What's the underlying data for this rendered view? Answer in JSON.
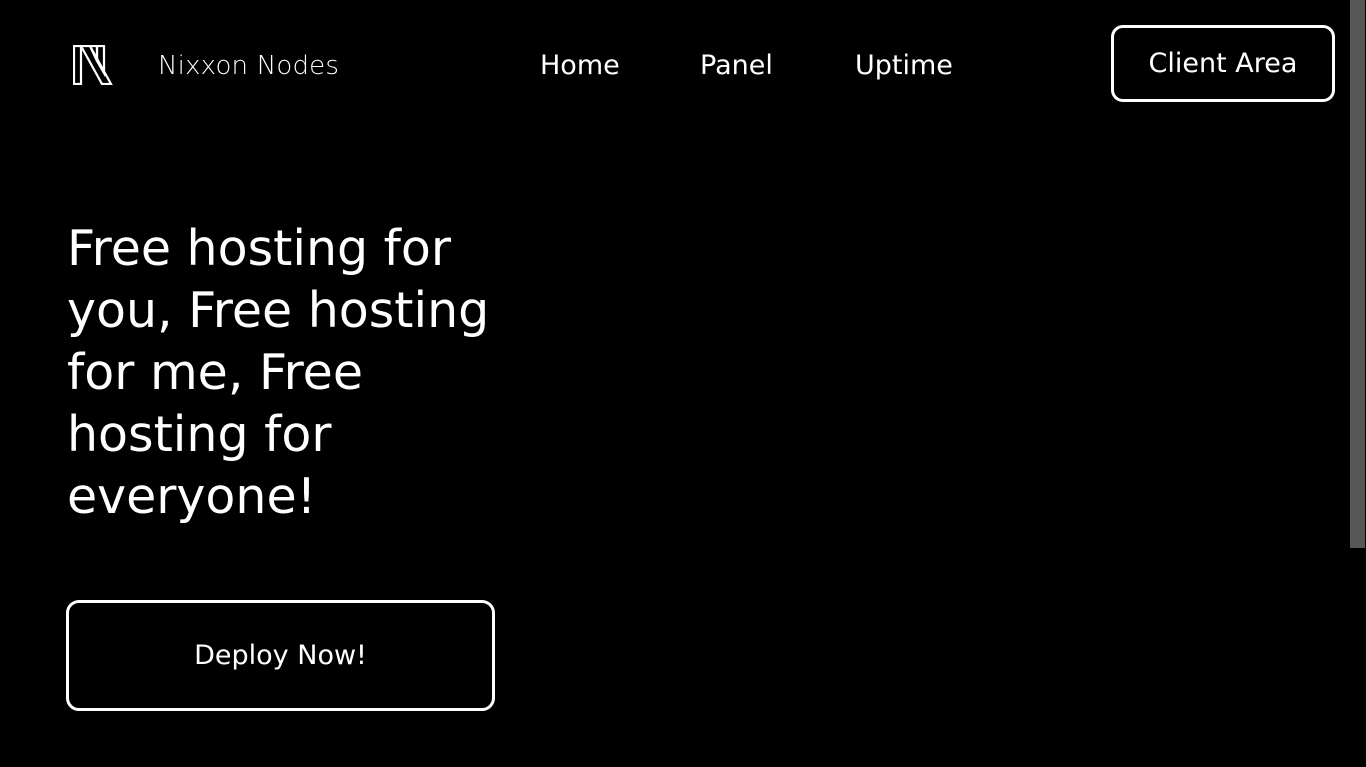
{
  "header": {
    "logo_icon": "nixxon-logo-icon",
    "brand": "Nixxon Nodes",
    "nav": [
      {
        "label": "Home"
      },
      {
        "label": "Panel"
      },
      {
        "label": "Uptime"
      }
    ],
    "client_area_label": "Client Area"
  },
  "hero": {
    "title": "Free hosting for you, Free hosting for me, Free hosting for everyone!",
    "cta_label": "Deploy Now!"
  },
  "colors": {
    "background": "#000000",
    "foreground": "#ffffff",
    "scroll_thumb": "#575757"
  }
}
